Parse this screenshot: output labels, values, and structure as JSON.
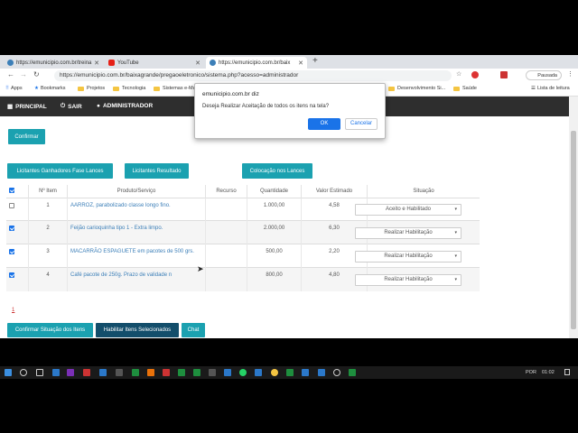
{
  "colors": {
    "accent": "#1ba1b0",
    "dark_button": "#134e6b",
    "navbar": "#2e2e2e",
    "ok_button": "#1a73e8"
  },
  "browser": {
    "tabs": [
      {
        "title": "https://emunicipio.com.br/treina",
        "icon": "globe-icon"
      },
      {
        "title": "YouTube",
        "icon": "youtube-icon"
      },
      {
        "title": "https://emunicipio.com.br/baix",
        "icon": "globe-icon"
      }
    ],
    "url": "https://emunicipio.com.br/baixagrande/pregaoeletronico/sistema.php?acesso=administrador",
    "profile": "Pausada",
    "bookmarks": [
      "Apps",
      "Bookmarks",
      "Projetos",
      "Tecnologia",
      "Sistemas e-Mu",
      "Desenvolvimento Si...",
      "Saúde",
      "Lista de leitura"
    ]
  },
  "nav": {
    "principal": "PRINCIPAL",
    "sair": "SAIR",
    "administrador": "ADMINISTRADOR"
  },
  "buttons": {
    "confirmar": "Confirmar",
    "licitantes_ganhadores": "Licitantes Ganhadores Fase Lances",
    "licitantes_resultado": "Licitantes Resultado",
    "colocacao": "Colocação nos Lances",
    "confirmar_situacao": "Confirmar Situação dos Itens",
    "habilitar": "Habilitar Itens Selecionados",
    "chat": "Chat"
  },
  "table": {
    "headers": [
      "Nº Item",
      "Produto/Serviço",
      "Recurso",
      "Quantidade",
      "Valor Estimado",
      "Situação"
    ],
    "rows": [
      {
        "checked": false,
        "item": "1",
        "produto": "AARROZ, parabolizado classe longo fino.",
        "quantidade": "1.000,00",
        "valor": "4,58",
        "situacao": "Aceito e Habilitado"
      },
      {
        "checked": true,
        "item": "2",
        "produto": "Feijão carioquinha tipo 1 - Extra limpo.",
        "quantidade": "2.000,00",
        "valor": "6,30",
        "situacao": "Realizar Habilitação"
      },
      {
        "checked": true,
        "item": "3",
        "produto": "MACARRÃO ESPAGUETE em pacotes de 500 grs.",
        "quantidade": "500,00",
        "valor": "2,20",
        "situacao": "Realizar Habilitação"
      },
      {
        "checked": true,
        "item": "4",
        "produto": "Café pacote de 250g. Prazo de validade n",
        "quantidade": "800,00",
        "valor": "4,80",
        "situacao": "Realizar Habilitação"
      }
    ]
  },
  "pagination": "1",
  "dialog": {
    "title": "emunicipio.com.br diz",
    "message": "Deseja Realizar Aceitação de todos os itens na tela?",
    "ok": "OK",
    "cancel": "Cancelar"
  },
  "taskbar": {
    "lang": "POR",
    "time": "01:02"
  }
}
